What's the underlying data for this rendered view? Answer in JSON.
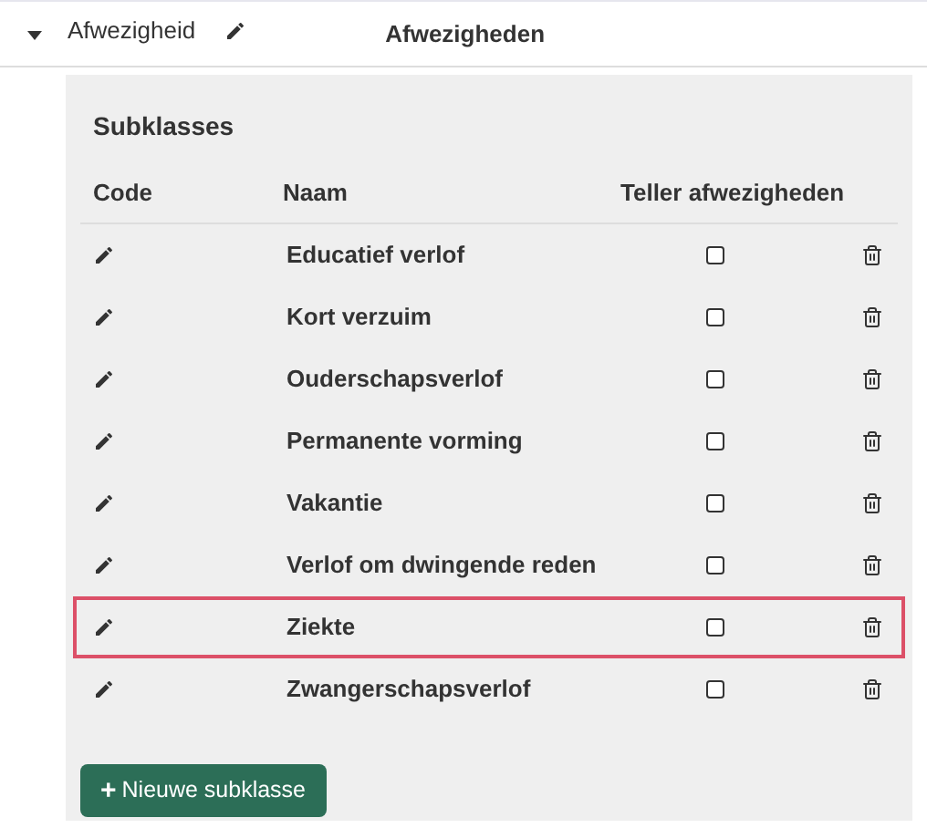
{
  "header": {
    "label": "Afwezigheid",
    "expanded": true,
    "title": "Afwezigheden"
  },
  "panel": {
    "title": "Subklasses",
    "columns": [
      "Code",
      "Naam",
      "Teller afwezigheden"
    ],
    "rows": [
      {
        "name": "Educatief verlof",
        "checked": false,
        "selected": false
      },
      {
        "name": "Kort verzuim",
        "checked": false,
        "selected": false
      },
      {
        "name": "Ouderschapsverlof",
        "checked": false,
        "selected": false
      },
      {
        "name": "Permanente vorming",
        "checked": false,
        "selected": false
      },
      {
        "name": "Vakantie",
        "checked": false,
        "selected": false
      },
      {
        "name": "Verlof om dwingende reden",
        "checked": false,
        "selected": false
      },
      {
        "name": "Ziekte",
        "checked": false,
        "selected": true
      },
      {
        "name": "Zwangerschapsverlof",
        "checked": false,
        "selected": false
      }
    ],
    "add_button": {
      "icon": "+",
      "label": "Nieuwe subklasse"
    }
  }
}
